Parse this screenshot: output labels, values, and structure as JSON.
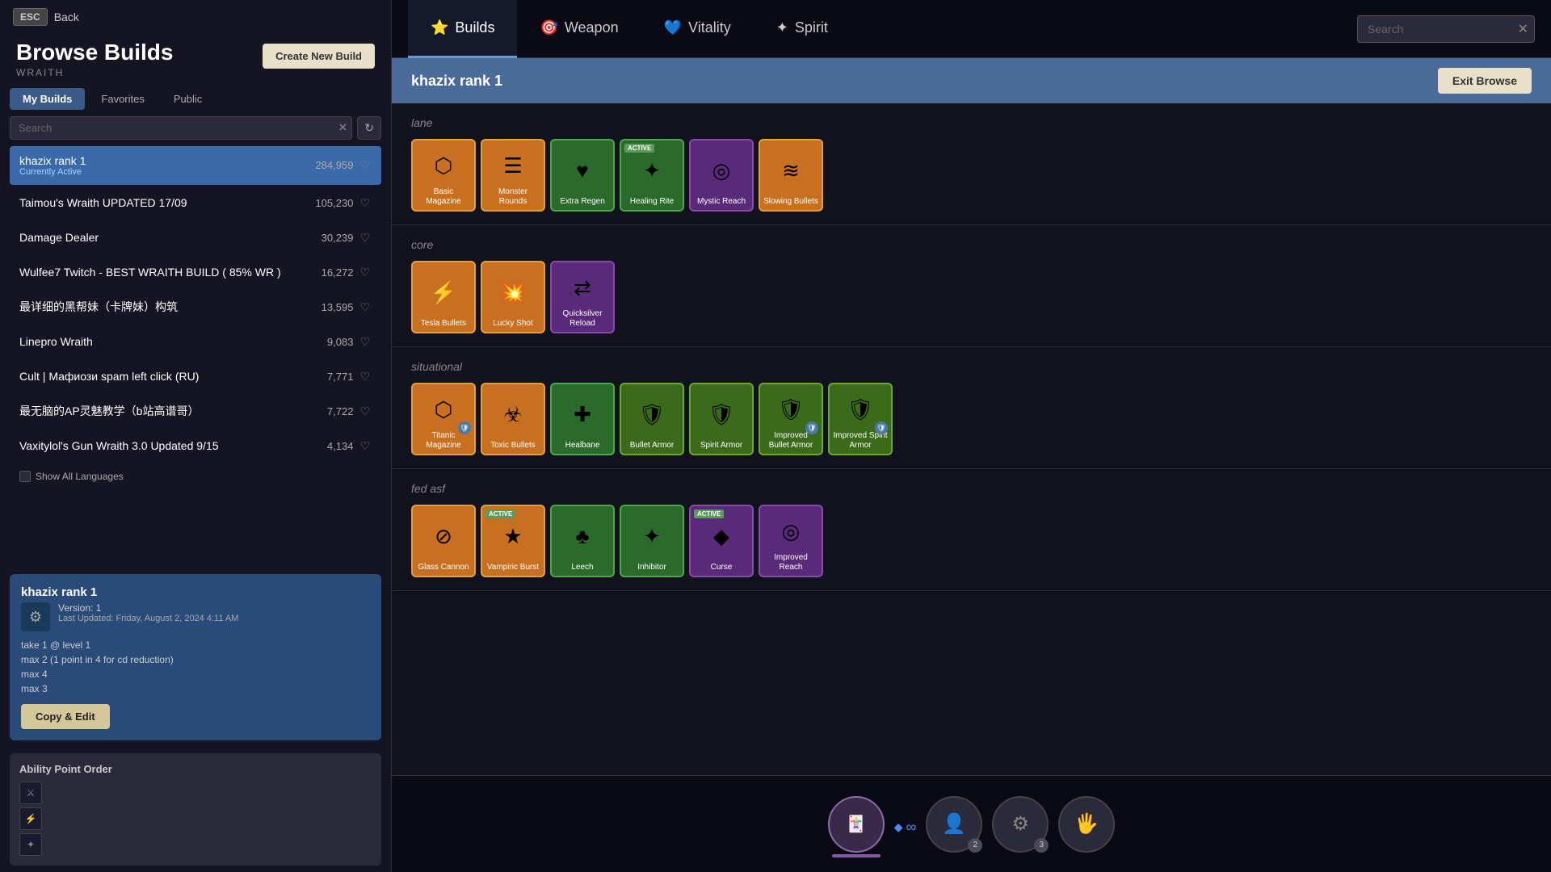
{
  "app": {
    "title": "Browse Builds",
    "subtitle": "WRAITH"
  },
  "esc_back": {
    "esc_label": "ESC",
    "back_label": "Back"
  },
  "create_btn": "Create New Build",
  "tabs": [
    {
      "id": "my-builds",
      "label": "My Builds",
      "active": true
    },
    {
      "id": "favorites",
      "label": "Favorites",
      "active": false
    },
    {
      "id": "public",
      "label": "Public",
      "active": false
    }
  ],
  "search": {
    "placeholder": "Search"
  },
  "builds": [
    {
      "id": 1,
      "name": "khazix rank 1",
      "sub": "Currently Active",
      "count": "284,959",
      "active": true
    },
    {
      "id": 2,
      "name": "Taimou's Wraith UPDATED 17/09",
      "count": "105,230",
      "active": false
    },
    {
      "id": 3,
      "name": "Damage Dealer",
      "count": "30,239",
      "active": false
    },
    {
      "id": 4,
      "name": "Wulfee7 Twitch - BEST WRAITH BUILD ( 85% WR )",
      "count": "16,272",
      "active": false
    },
    {
      "id": 5,
      "name": "最详细的黑帮妹（卡牌妹）构筑",
      "count": "13,595",
      "active": false
    },
    {
      "id": 6,
      "name": "Linepro Wraith",
      "count": "9,083",
      "active": false
    },
    {
      "id": 7,
      "name": "Cult | Мафиози spam left click (RU)",
      "count": "7,771",
      "active": false
    },
    {
      "id": 8,
      "name": "最无脑的AP灵魅教学（b站高谱哥）",
      "count": "7,722",
      "active": false
    },
    {
      "id": 9,
      "name": "Vaxitylol's Gun Wraith 3.0 Updated 9/15",
      "count": "4,134",
      "active": false
    }
  ],
  "show_all_languages": "Show All Languages",
  "build_detail": {
    "title": "khazix rank 1",
    "version": "Version: 1",
    "last_updated": "Last Updated: Friday, August 2, 2024 4:11 AM",
    "notes": "take 1 @ level 1\nmax 2 (1 point in 4 for cd reduction)\nmax 4\nmax 3",
    "copy_edit_label": "Copy & Edit"
  },
  "ability_order": {
    "title": "Ability Point Order"
  },
  "nav_tabs": [
    {
      "id": "builds",
      "label": "Builds",
      "icon": "⭐",
      "active": true
    },
    {
      "id": "weapon",
      "label": "Weapon",
      "icon": "🎯",
      "active": false
    },
    {
      "id": "vitality",
      "label": "Vitality",
      "icon": "💙",
      "active": false
    },
    {
      "id": "spirit",
      "label": "Spirit",
      "icon": "✦",
      "active": false
    }
  ],
  "nav_search": {
    "placeholder": "Search"
  },
  "build_view": {
    "title": "khazix rank 1",
    "exit_browse": "Exit Browse",
    "sections": [
      {
        "id": "lane",
        "label": "lane",
        "items": [
          {
            "id": 1,
            "name": "Basic Magazine",
            "color": "orange",
            "icon": "⬡",
            "badge": null
          },
          {
            "id": 2,
            "name": "Monster Rounds",
            "color": "orange",
            "icon": "☰",
            "badge": null
          },
          {
            "id": 3,
            "name": "Extra Regen",
            "color": "green",
            "icon": "♥",
            "badge": null
          },
          {
            "id": 4,
            "name": "Healing Rite",
            "color": "green",
            "icon": "✦",
            "badge": "ACTIVE"
          },
          {
            "id": 5,
            "name": "Mystic Reach",
            "color": "purple",
            "icon": "◎",
            "badge": null
          },
          {
            "id": 6,
            "name": "Slowing Bullets",
            "color": "orange",
            "icon": "≋",
            "badge": null
          }
        ]
      },
      {
        "id": "core",
        "label": "core",
        "items": [
          {
            "id": 7,
            "name": "Tesla Bullets",
            "color": "orange",
            "icon": "⚡",
            "badge": null
          },
          {
            "id": 8,
            "name": "Lucky Shot",
            "color": "orange",
            "icon": "💥",
            "badge": null
          },
          {
            "id": 9,
            "name": "Quicksilver Reload",
            "color": "purple",
            "icon": "⇄",
            "badge": null
          }
        ]
      },
      {
        "id": "situational",
        "label": "situational",
        "items": [
          {
            "id": 10,
            "name": "Titanic Magazine",
            "color": "orange",
            "icon": "⬡",
            "badge": null,
            "shield": true
          },
          {
            "id": 11,
            "name": "Toxic Bullets",
            "color": "orange",
            "icon": "☣",
            "badge": null
          },
          {
            "id": 12,
            "name": "Healbane",
            "color": "green",
            "icon": "✚",
            "badge": null
          },
          {
            "id": 13,
            "name": "Bullet Armor",
            "color": "lime",
            "icon": "⬡",
            "badge": null
          },
          {
            "id": 14,
            "name": "Spirit Armor",
            "color": "lime",
            "icon": "⬡",
            "badge": null
          },
          {
            "id": 15,
            "name": "Improved Bullet Armor",
            "color": "lime",
            "icon": "⬡",
            "badge": null,
            "shield": true
          },
          {
            "id": 16,
            "name": "Improved Spirit Armor",
            "color": "lime",
            "icon": "⬡",
            "badge": null,
            "shield": true
          }
        ]
      },
      {
        "id": "fed-asf",
        "label": "fed asf",
        "items": [
          {
            "id": 17,
            "name": "Glass Cannon",
            "color": "orange",
            "icon": "⊘",
            "badge": null
          },
          {
            "id": 18,
            "name": "Vampiric Burst",
            "color": "orange",
            "icon": "★",
            "badge": "ACTIVE"
          },
          {
            "id": 19,
            "name": "Leech",
            "color": "green",
            "icon": "♣",
            "badge": null
          },
          {
            "id": 20,
            "name": "Inhibitor",
            "color": "green",
            "icon": "✦",
            "badge": null
          },
          {
            "id": 21,
            "name": "Curse",
            "color": "purple",
            "icon": "◆",
            "badge": "ACTIVE"
          },
          {
            "id": 22,
            "name": "Improved Reach",
            "color": "purple",
            "icon": "◎",
            "badge": null
          }
        ]
      }
    ]
  },
  "ability_slots": [
    {
      "id": 1,
      "icon": "🃏",
      "active": true,
      "has_bar": true
    },
    {
      "id": 2,
      "icon": "👤",
      "num": "2",
      "active": false
    },
    {
      "id": 3,
      "icon": "⚙",
      "num": "3",
      "active": false
    },
    {
      "id": 4,
      "icon": "🖐",
      "active": false
    }
  ],
  "colors": {
    "orange_item": "#c87020",
    "green_item": "#2a6a2a",
    "purple_item": "#5a2a7a",
    "lime_item": "#3a6a1a",
    "active_tab": "#3a6aaa",
    "header_bg": "#4a6a9a"
  }
}
